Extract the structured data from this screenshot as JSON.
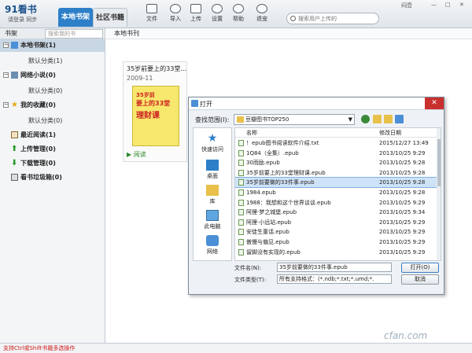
{
  "app": {
    "logo": "91看书",
    "login_text": "请登录",
    "login_sync": "同步"
  },
  "header": {
    "tabs": [
      {
        "label": "本地书架"
      },
      {
        "label": "社区书籍"
      }
    ],
    "tools": [
      {
        "label": "文件"
      },
      {
        "label": "导入"
      },
      {
        "label": "上传"
      },
      {
        "label": "设置"
      },
      {
        "label": "帮助"
      },
      {
        "label": "退宠"
      }
    ],
    "search": {
      "placeholder": "搜索用户上传的"
    },
    "window_controls": "闷壶"
  },
  "sidebar": {
    "title": "书架",
    "search_placeholder": "搜索我的书",
    "items": [
      {
        "label": "本地书架(1)",
        "sub": "默认分类(1)"
      },
      {
        "label": "网络小说(0)",
        "sub": "默认分类(0)"
      },
      {
        "label": "我的收藏(0)",
        "sub": "默认分类(0)"
      },
      {
        "label": "最近阅读(1)"
      },
      {
        "label": "上传管理(0)"
      },
      {
        "label": "下载管理(0)"
      },
      {
        "label": "看书垃圾箱(0)"
      }
    ]
  },
  "content": {
    "heading": "本地书刊",
    "book": {
      "title": "35岁前要上的33堂...",
      "date": "2009-11",
      "cover_line1": "35岁前",
      "cover_line2": "要上的33堂",
      "cover_line3": "理财课",
      "read_label": "阅读"
    }
  },
  "dialog": {
    "title": "打开",
    "lookin_label": "查找范围(I):",
    "lookin_value": "豆瓣图书TOP250",
    "places": [
      {
        "label": "快速访问"
      },
      {
        "label": "桌面"
      },
      {
        "label": "库"
      },
      {
        "label": "此电脑"
      },
      {
        "label": "网络"
      }
    ],
    "columns": {
      "name": "名称",
      "date": "修改日期"
    },
    "files": [
      {
        "name": "！epub图书阅读软件介绍.txt",
        "date": "2015/12/27 13:49"
      },
      {
        "name": "1Q84（全集）.epub",
        "date": "2013/10/25 9:29"
      },
      {
        "name": "30而励.epub",
        "date": "2013/10/25 9:28"
      },
      {
        "name": "35岁前要上的33堂理财课.epub",
        "date": "2013/10/25 9:28"
      },
      {
        "name": "35岁前要做的33件事.epub",
        "date": "2013/10/25 9:28"
      },
      {
        "name": "1984.epub",
        "date": "2013/10/25 9:28"
      },
      {
        "name": "1988：我想和这个世界谈谈.epub",
        "date": "2013/10/25 9:29"
      },
      {
        "name": "阿狸·梦之城堡.epub",
        "date": "2013/10/25 9:34"
      },
      {
        "name": "阿狸·小远站.epub",
        "date": "2013/10/25 9:29"
      },
      {
        "name": "安徒生童话.epub",
        "date": "2013/10/25 9:29"
      },
      {
        "name": "傲慢与偏见.epub",
        "date": "2013/10/25 9:29"
      },
      {
        "name": "留脚没有实现的.epub",
        "date": "2013/10/25 9:29"
      }
    ],
    "filename_label": "文件名(N):",
    "filename_value": "35岁前要做的33件事.epub",
    "filetype_label": "文件类型(T):",
    "filetype_value": "所有支持格式：(*.ndb;*.txt;*.umd;*.",
    "open_label": "打开(O)",
    "cancel_label": "取消",
    "close_glyph": "✕"
  },
  "status": {
    "text": "支持Ctrl或Shift书籍多选操作"
  },
  "watermark": "cfan.com",
  "colors": {
    "accent": "#2d7fc8",
    "selection": "#cfe3f8",
    "status_text": "#d01818"
  }
}
